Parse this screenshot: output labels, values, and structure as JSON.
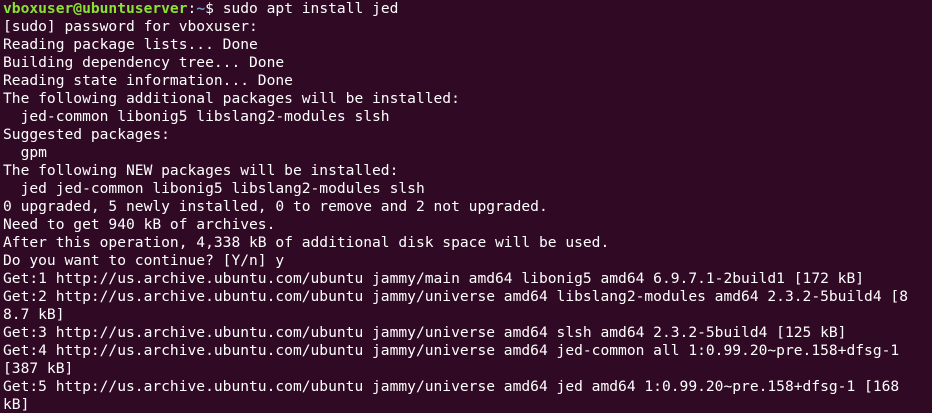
{
  "prompt": {
    "user_host": "vboxuser@ubuntuserver",
    "separator": ":",
    "path": "~",
    "symbol": "$ ",
    "command": "sudo apt install jed"
  },
  "colors": {
    "background": "#300a24",
    "foreground": "#ffffff",
    "user_host": "#8ae234",
    "path": "#729fcf"
  },
  "output_lines": [
    "[sudo] password for vboxuser:",
    "Reading package lists... Done",
    "Building dependency tree... Done",
    "Reading state information... Done",
    "The following additional packages will be installed:",
    "  jed-common libonig5 libslang2-modules slsh",
    "Suggested packages:",
    "  gpm",
    "The following NEW packages will be installed:",
    "  jed jed-common libonig5 libslang2-modules slsh",
    "0 upgraded, 5 newly installed, 0 to remove and 2 not upgraded.",
    "Need to get 940 kB of archives.",
    "After this operation, 4,338 kB of additional disk space will be used.",
    "Do you want to continue? [Y/n] y",
    "Get:1 http://us.archive.ubuntu.com/ubuntu jammy/main amd64 libonig5 amd64 6.9.7.1-2build1 [172 kB]",
    "Get:2 http://us.archive.ubuntu.com/ubuntu jammy/universe amd64 libslang2-modules amd64 2.3.2-5build4 [8",
    "8.7 kB]",
    "Get:3 http://us.archive.ubuntu.com/ubuntu jammy/universe amd64 slsh amd64 2.3.2-5build4 [125 kB]",
    "Get:4 http://us.archive.ubuntu.com/ubuntu jammy/universe amd64 jed-common all 1:0.99.20~pre.158+dfsg-1",
    "[387 kB]",
    "Get:5 http://us.archive.ubuntu.com/ubuntu jammy/universe amd64 jed amd64 1:0.99.20~pre.158+dfsg-1 [168",
    "kB]"
  ]
}
